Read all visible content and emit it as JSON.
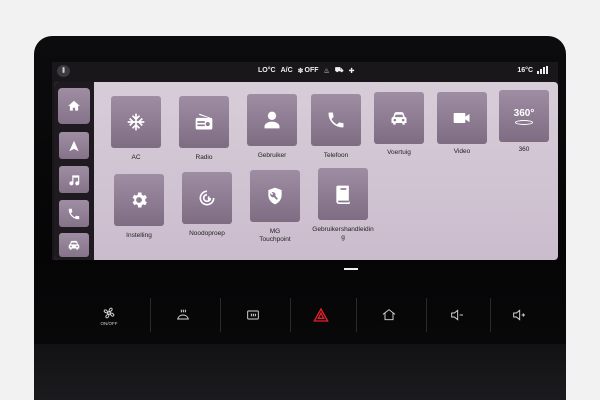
{
  "status": {
    "temperature_left": "LO°C",
    "ac": "A/C",
    "fan": "OFF",
    "temperature_right": "16°C"
  },
  "sidebar": {
    "items": [
      {
        "name": "home-icon"
      },
      {
        "name": "navigation-icon"
      },
      {
        "name": "music-icon"
      },
      {
        "name": "phone-icon"
      },
      {
        "name": "car-icon"
      }
    ]
  },
  "apps": [
    {
      "label": "AC",
      "icon": "snowflake-icon"
    },
    {
      "label": "Radio",
      "icon": "radio-icon"
    },
    {
      "label": "Gebruiker",
      "icon": "user-icon"
    },
    {
      "label": "Telefoon",
      "icon": "phone-icon"
    },
    {
      "label": "Voertuig",
      "icon": "car-icon"
    },
    {
      "label": "Video",
      "icon": "video-icon"
    },
    {
      "label": "360",
      "icon": "360-icon",
      "icon_text": "360°"
    },
    {
      "label": "Instelling",
      "icon": "gear-icon"
    },
    {
      "label": "Noodoproep",
      "icon": "emergency-call-icon"
    },
    {
      "label_line1": "MG",
      "label_line2": "Touchpoint",
      "icon": "wrench-shield-icon"
    },
    {
      "label_line1": "Gebruikershandleidin",
      "label_line2": "g",
      "icon": "manual-icon"
    }
  ],
  "controls": {
    "on_off_text": "ON/OFF",
    "items": [
      "auto-on-off-button",
      "front-defrost-button",
      "rear-defrost-button",
      "hazard-button",
      "home-button",
      "volume-down-button",
      "volume-up-button"
    ],
    "hazard_color": "#e0202a"
  },
  "colors": {
    "tile": "#8f7e94",
    "panel": "#d2c6d3"
  }
}
